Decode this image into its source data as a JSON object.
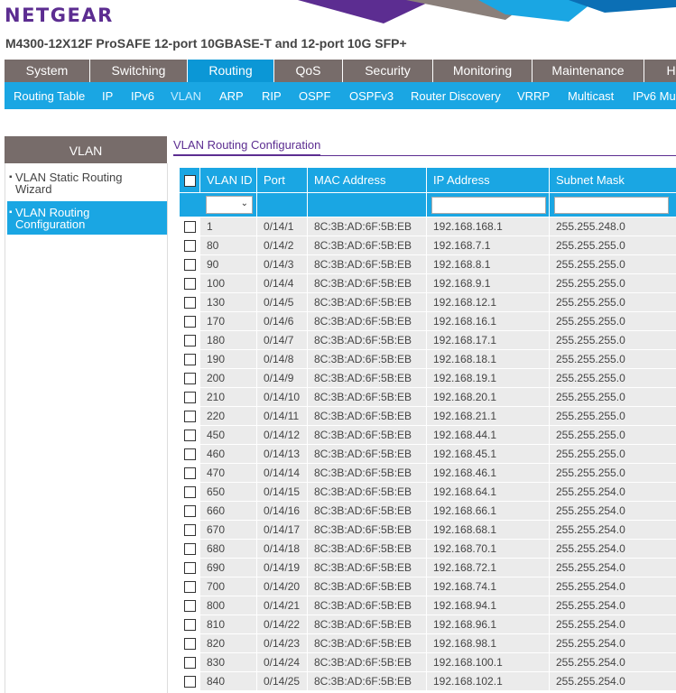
{
  "header": {
    "logo": "NETGEAR",
    "model": "M4300-12X12F ProSAFE 12-port 10GBASE-T and 12-port 10G SFP+"
  },
  "top_nav": [
    "System",
    "Switching",
    "Routing",
    "QoS",
    "Security",
    "Monitoring",
    "Maintenance",
    "H"
  ],
  "top_nav_active": "Routing",
  "sub_nav": [
    "Routing Table",
    "IP",
    "IPv6",
    "VLAN",
    "ARP",
    "RIP",
    "OSPF",
    "OSPFv3",
    "Router Discovery",
    "VRRP",
    "Multicast",
    "IPv6 Mu"
  ],
  "sub_nav_active": "VLAN",
  "sidebar": {
    "header": "VLAN",
    "items": [
      "VLAN Static Routing Wizard",
      "VLAN Routing Configuration"
    ]
  },
  "section_title": "VLAN Routing Configuration",
  "table": {
    "headers": [
      "VLAN ID",
      "Port",
      "MAC Address",
      "IP Address",
      "Subnet Mask"
    ],
    "rows": [
      [
        "1",
        "0/14/1",
        "8C:3B:AD:6F:5B:EB",
        "192.168.168.1",
        "255.255.248.0"
      ],
      [
        "80",
        "0/14/2",
        "8C:3B:AD:6F:5B:EB",
        "192.168.7.1",
        "255.255.255.0"
      ],
      [
        "90",
        "0/14/3",
        "8C:3B:AD:6F:5B:EB",
        "192.168.8.1",
        "255.255.255.0"
      ],
      [
        "100",
        "0/14/4",
        "8C:3B:AD:6F:5B:EB",
        "192.168.9.1",
        "255.255.255.0"
      ],
      [
        "130",
        "0/14/5",
        "8C:3B:AD:6F:5B:EB",
        "192.168.12.1",
        "255.255.255.0"
      ],
      [
        "170",
        "0/14/6",
        "8C:3B:AD:6F:5B:EB",
        "192.168.16.1",
        "255.255.255.0"
      ],
      [
        "180",
        "0/14/7",
        "8C:3B:AD:6F:5B:EB",
        "192.168.17.1",
        "255.255.255.0"
      ],
      [
        "190",
        "0/14/8",
        "8C:3B:AD:6F:5B:EB",
        "192.168.18.1",
        "255.255.255.0"
      ],
      [
        "200",
        "0/14/9",
        "8C:3B:AD:6F:5B:EB",
        "192.168.19.1",
        "255.255.255.0"
      ],
      [
        "210",
        "0/14/10",
        "8C:3B:AD:6F:5B:EB",
        "192.168.20.1",
        "255.255.255.0"
      ],
      [
        "220",
        "0/14/11",
        "8C:3B:AD:6F:5B:EB",
        "192.168.21.1",
        "255.255.255.0"
      ],
      [
        "450",
        "0/14/12",
        "8C:3B:AD:6F:5B:EB",
        "192.168.44.1",
        "255.255.255.0"
      ],
      [
        "460",
        "0/14/13",
        "8C:3B:AD:6F:5B:EB",
        "192.168.45.1",
        "255.255.255.0"
      ],
      [
        "470",
        "0/14/14",
        "8C:3B:AD:6F:5B:EB",
        "192.168.46.1",
        "255.255.255.0"
      ],
      [
        "650",
        "0/14/15",
        "8C:3B:AD:6F:5B:EB",
        "192.168.64.1",
        "255.255.254.0"
      ],
      [
        "660",
        "0/14/16",
        "8C:3B:AD:6F:5B:EB",
        "192.168.66.1",
        "255.255.254.0"
      ],
      [
        "670",
        "0/14/17",
        "8C:3B:AD:6F:5B:EB",
        "192.168.68.1",
        "255.255.254.0"
      ],
      [
        "680",
        "0/14/18",
        "8C:3B:AD:6F:5B:EB",
        "192.168.70.1",
        "255.255.254.0"
      ],
      [
        "690",
        "0/14/19",
        "8C:3B:AD:6F:5B:EB",
        "192.168.72.1",
        "255.255.254.0"
      ],
      [
        "700",
        "0/14/20",
        "8C:3B:AD:6F:5B:EB",
        "192.168.74.1",
        "255.255.254.0"
      ],
      [
        "800",
        "0/14/21",
        "8C:3B:AD:6F:5B:EB",
        "192.168.94.1",
        "255.255.254.0"
      ],
      [
        "810",
        "0/14/22",
        "8C:3B:AD:6F:5B:EB",
        "192.168.96.1",
        "255.255.254.0"
      ],
      [
        "820",
        "0/14/23",
        "8C:3B:AD:6F:5B:EB",
        "192.168.98.1",
        "255.255.254.0"
      ],
      [
        "830",
        "0/14/24",
        "8C:3B:AD:6F:5B:EB",
        "192.168.100.1",
        "255.255.254.0"
      ],
      [
        "840",
        "0/14/25",
        "8C:3B:AD:6F:5B:EB",
        "192.168.102.1",
        "255.255.254.0"
      ]
    ]
  },
  "icons": {
    "checkbox": "checkbox-icon",
    "dropdown": "chevron-down-icon",
    "bullet": "bullet-icon"
  },
  "colors": {
    "brand_purple": "#5c2d91",
    "nav_gray": "#776c6a",
    "accent_blue": "#1aa6e3",
    "active_tab_blue": "#0b97d6"
  }
}
